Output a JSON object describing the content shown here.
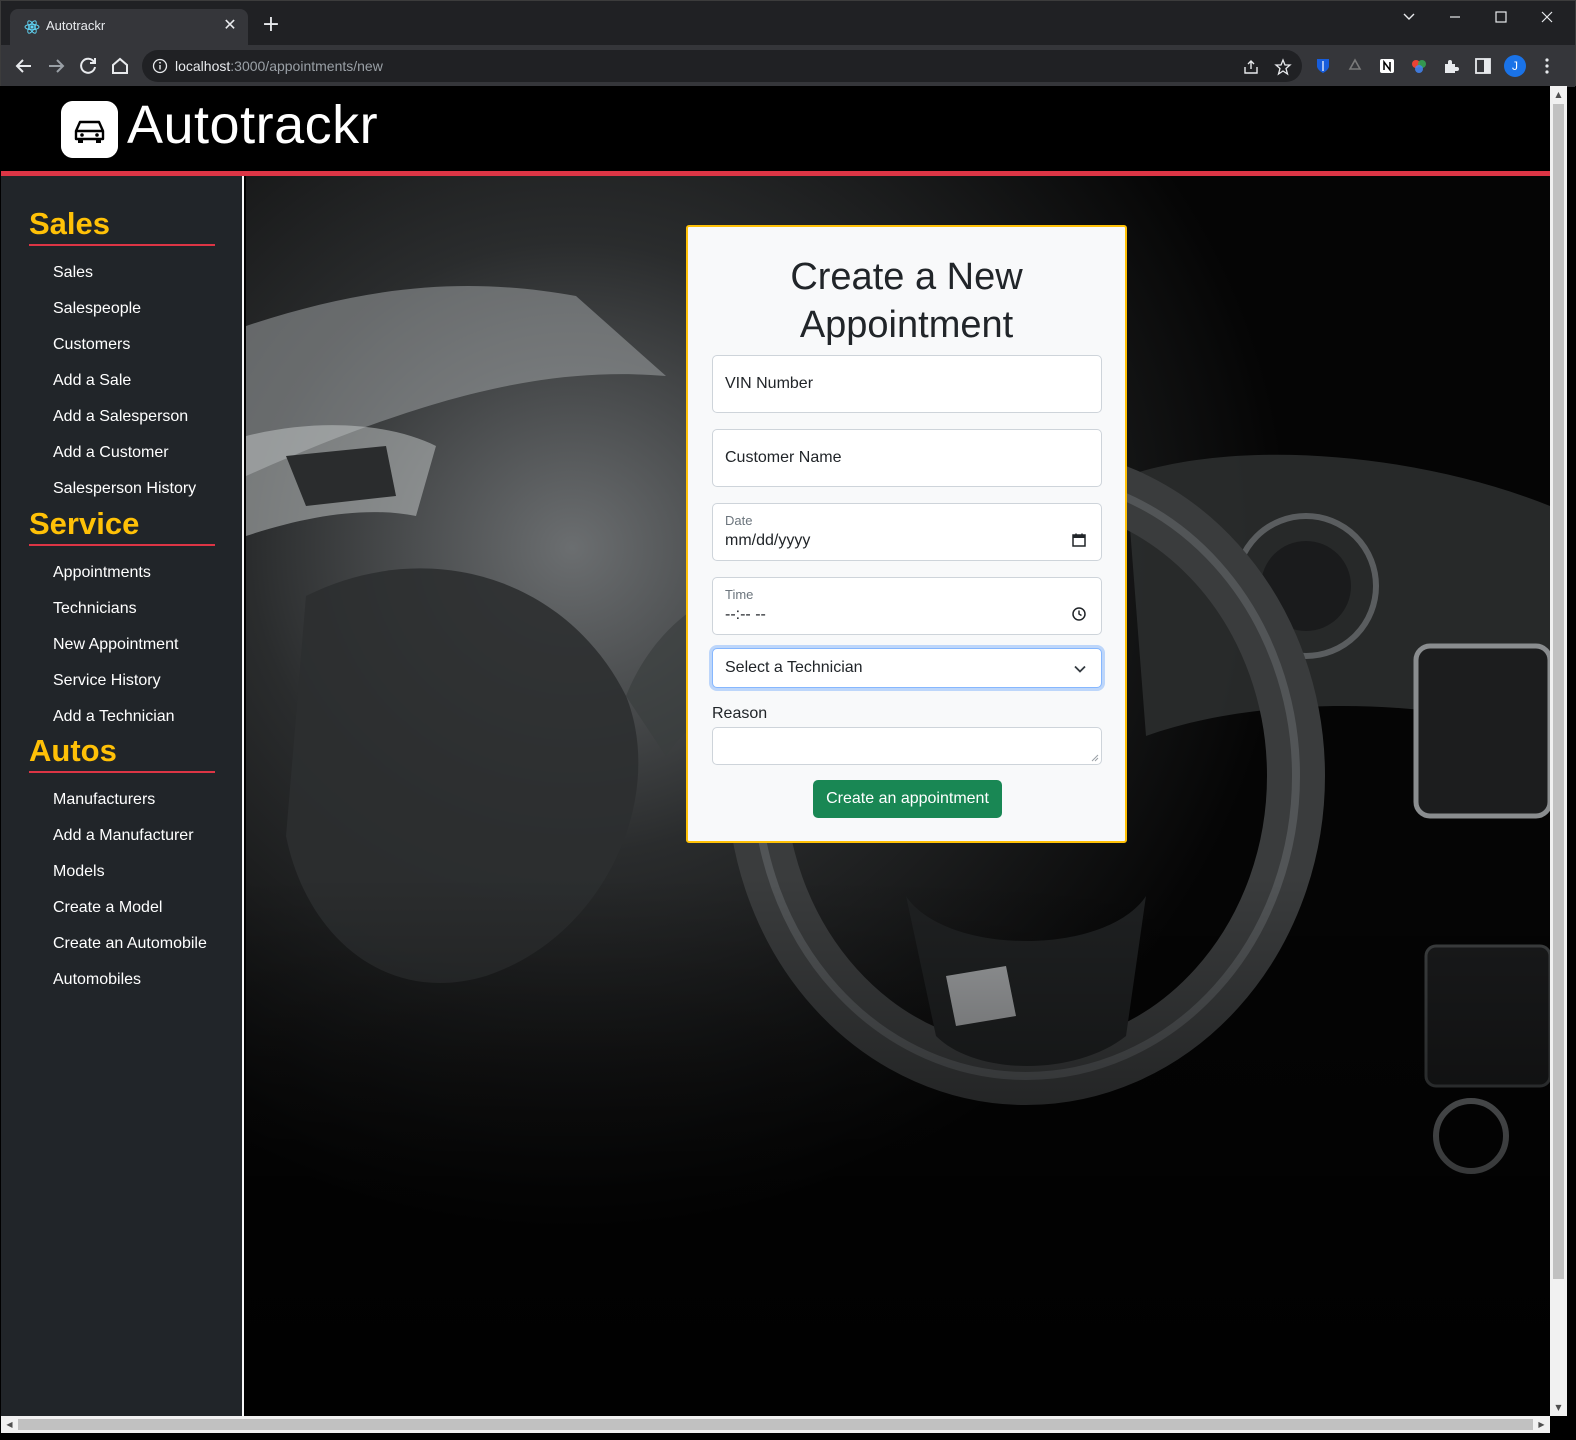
{
  "browser": {
    "tab_title": "Autotrackr",
    "tab_close": "✕",
    "new_tab": "+",
    "url_host": "localhost",
    "url_path": ":3000/appointments/new",
    "profile_initial": "J"
  },
  "header": {
    "brand": "Autotrackr"
  },
  "sidebar": {
    "sections": [
      {
        "title": "Sales",
        "links": [
          "Sales",
          "Salespeople",
          "Customers",
          "Add a Sale",
          "Add a Salesperson",
          "Add a Customer",
          "Salesperson History"
        ]
      },
      {
        "title": "Service",
        "links": [
          "Appointments",
          "Technicians",
          "New Appointment",
          "Service History",
          "Add a Technician"
        ]
      },
      {
        "title": "Autos",
        "links": [
          "Manufacturers",
          "Add a Manufacturer",
          "Models",
          "Create a Model",
          "Create an Automobile",
          "Automobiles"
        ]
      }
    ]
  },
  "form": {
    "title": "Create a New Appointment",
    "vin_placeholder": "VIN Number",
    "customer_placeholder": "Customer Name",
    "date_label": "Date",
    "date_value": "mm/dd/yyyy",
    "time_label": "Time",
    "time_value": "--:-- --",
    "technician_select": "Select a Technician",
    "reason_label": "Reason",
    "submit_label": "Create an appointment"
  },
  "colors": {
    "accent_yellow": "#ffc107",
    "accent_red": "#dc3545",
    "submit_green": "#198754",
    "sidebar_bg": "#212529"
  }
}
